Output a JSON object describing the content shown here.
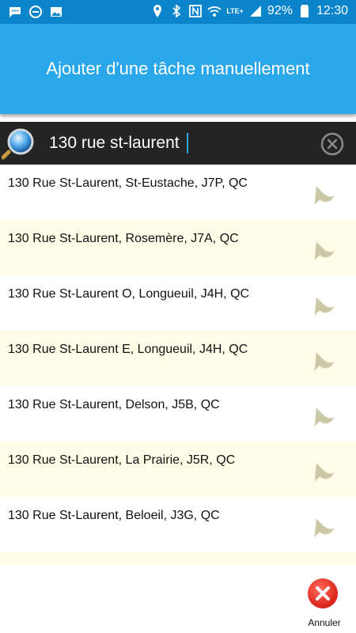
{
  "status_bar": {
    "battery": "92%",
    "time": "12:30",
    "network": "LTE+"
  },
  "header": {
    "title": "Ajouter d'une tâche manuellement"
  },
  "search": {
    "value": "130 rue st-laurent"
  },
  "results": [
    {
      "label": "130 Rue St-Laurent, St-Eustache, J7P, QC"
    },
    {
      "label": "130 Rue St-Laurent, Rosemère, J7A, QC"
    },
    {
      "label": "130 Rue St-Laurent O, Longueuil, J4H, QC"
    },
    {
      "label": "130 Rue St-Laurent E, Longueuil, J4H, QC"
    },
    {
      "label": "130 Rue St-Laurent, Delson, J5B, QC"
    },
    {
      "label": "130 Rue St-Laurent, La Prairie, J5R, QC"
    },
    {
      "label": "130 Rue St-Laurent, Beloeil, J3G, QC"
    }
  ],
  "footer": {
    "cancel_label": "Annuler"
  }
}
